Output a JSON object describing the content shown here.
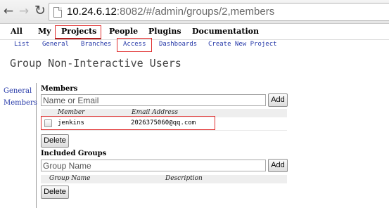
{
  "browser": {
    "back_icon": "arrow-left",
    "forward_icon": "arrow-right",
    "reload_icon": "reload",
    "url_host": "10.24.6.12",
    "url_path": ":8082/#/admin/groups/2,members"
  },
  "top_menu": {
    "items": [
      "All",
      "My",
      "Projects",
      "People",
      "Plugins",
      "Documentation"
    ],
    "selected": "Projects"
  },
  "sub_menu": {
    "items": [
      "List",
      "General",
      "Branches",
      "Access",
      "Dashboards",
      "Create New Project"
    ],
    "highlighted": "Access"
  },
  "page_title": "Group Non-Interactive Users",
  "left_nav": {
    "items": [
      "General",
      "Members"
    ]
  },
  "members": {
    "label": "Members",
    "input_placeholder": "Name or Email",
    "add_label": "Add",
    "columns": [
      "Member",
      "Email Address"
    ],
    "rows": [
      {
        "member": "jenkins",
        "email": "2026375060@qq.com",
        "checked": false
      }
    ],
    "delete_label": "Delete"
  },
  "included_groups": {
    "label": "Included Groups",
    "input_placeholder": "Group Name",
    "add_label": "Add",
    "columns": [
      "Group Name",
      "Description"
    ],
    "delete_label": "Delete"
  },
  "colors": {
    "highlight_box": "#e03030",
    "menu_underline": "#b32020",
    "link": "#2538a8"
  }
}
